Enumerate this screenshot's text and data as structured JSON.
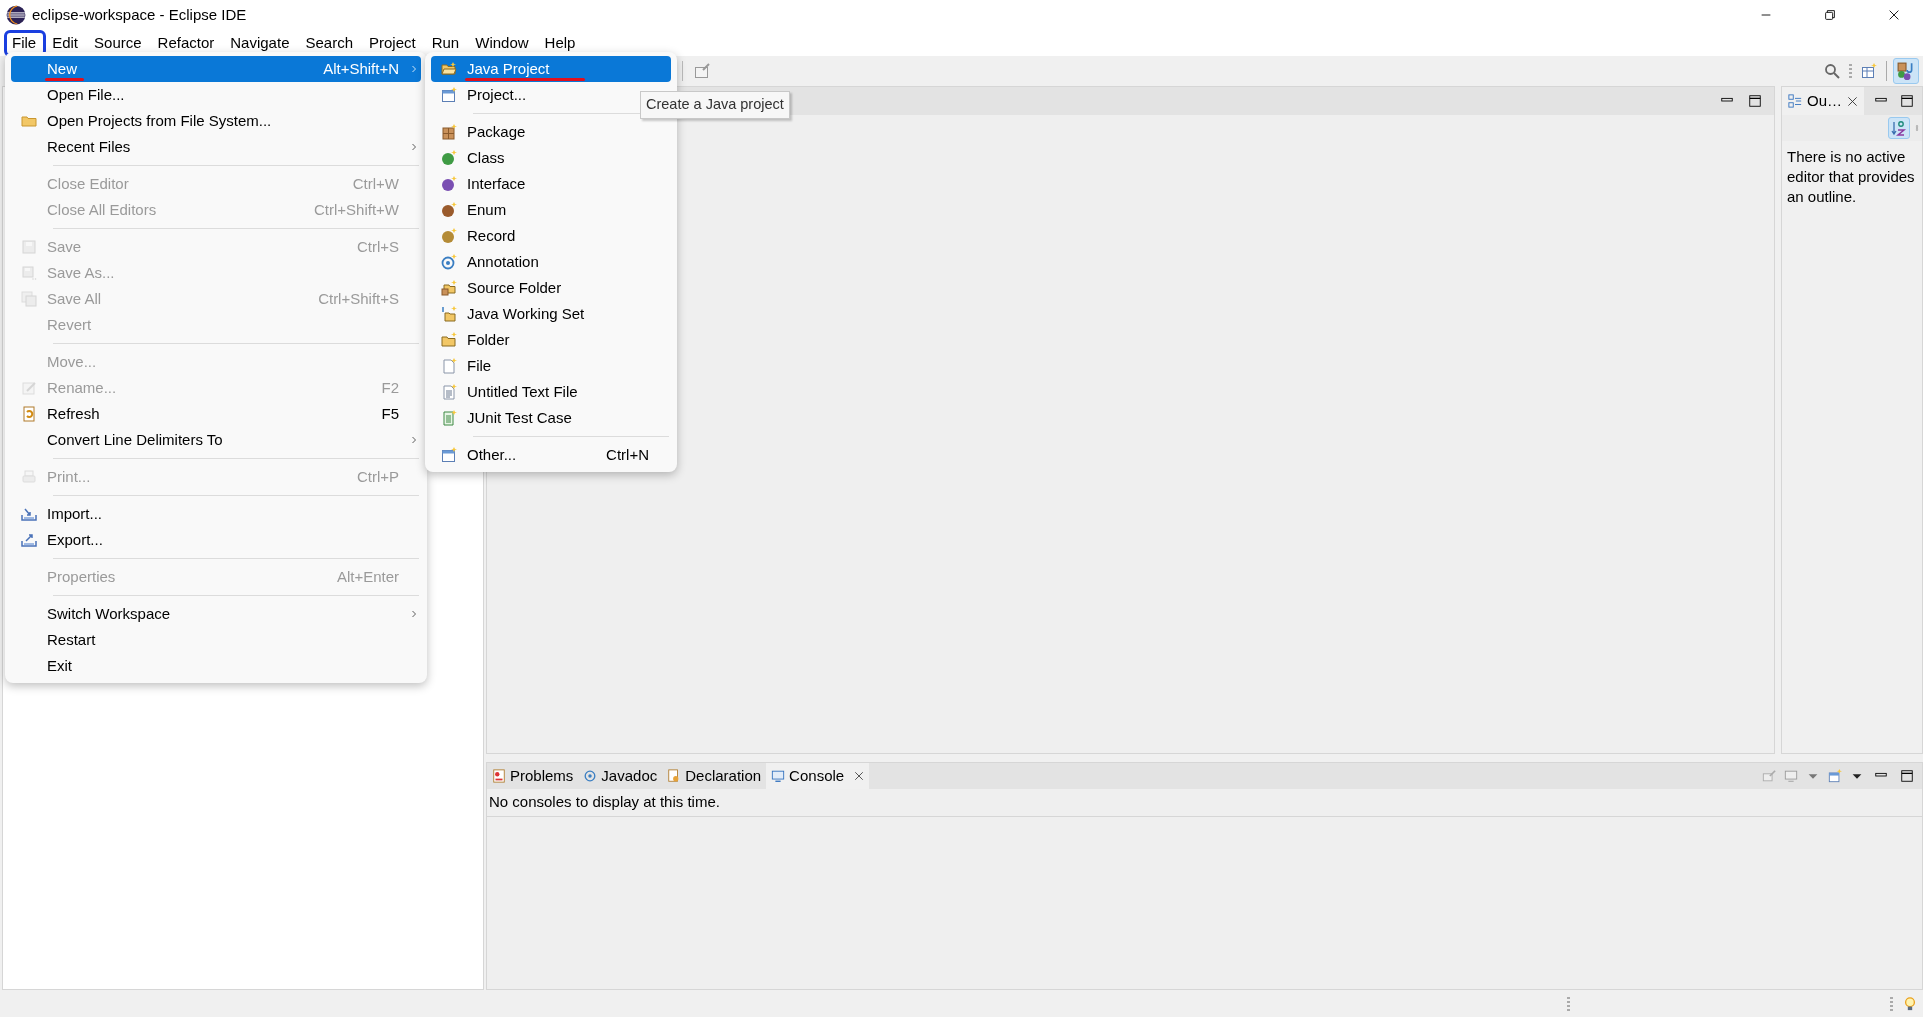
{
  "window": {
    "title": "eclipse-workspace - Eclipse IDE"
  },
  "menubar": [
    {
      "label": "File",
      "annotated": true
    },
    {
      "label": "Edit",
      "annotated": false
    },
    {
      "label": "Source",
      "annotated": false
    },
    {
      "label": "Refactor",
      "annotated": false
    },
    {
      "label": "Navigate",
      "annotated": false
    },
    {
      "label": "Search",
      "annotated": false
    },
    {
      "label": "Project",
      "annotated": false
    },
    {
      "label": "Run",
      "annotated": false
    },
    {
      "label": "Window",
      "annotated": false
    },
    {
      "label": "Help",
      "annotated": false
    }
  ],
  "file_menu": [
    {
      "kind": "item",
      "label": "New",
      "shortcut": "Alt+Shift+N",
      "submenu": true,
      "disabled": false,
      "selected": true,
      "annotated": true
    },
    {
      "kind": "item",
      "label": "Open File...",
      "disabled": false,
      "selected": false
    },
    {
      "kind": "item",
      "label": "Open Projects from File System...",
      "disabled": false,
      "selected": false
    },
    {
      "kind": "item",
      "label": "Recent Files",
      "submenu": true,
      "disabled": false,
      "selected": false
    },
    {
      "kind": "separator"
    },
    {
      "kind": "item",
      "label": "Close Editor",
      "shortcut": "Ctrl+W",
      "disabled": true,
      "selected": false
    },
    {
      "kind": "item",
      "label": "Close All Editors",
      "shortcut": "Ctrl+Shift+W",
      "disabled": true,
      "selected": false
    },
    {
      "kind": "separator"
    },
    {
      "kind": "item",
      "label": "Save",
      "shortcut": "Ctrl+S",
      "disabled": true,
      "selected": false
    },
    {
      "kind": "item",
      "label": "Save As...",
      "disabled": true,
      "selected": false
    },
    {
      "kind": "item",
      "label": "Save All",
      "shortcut": "Ctrl+Shift+S",
      "disabled": true,
      "selected": false
    },
    {
      "kind": "item",
      "label": "Revert",
      "disabled": true,
      "selected": false
    },
    {
      "kind": "separator"
    },
    {
      "kind": "item",
      "label": "Move...",
      "disabled": true,
      "selected": false
    },
    {
      "kind": "item",
      "label": "Rename...",
      "shortcut": "F2",
      "disabled": true,
      "selected": false
    },
    {
      "kind": "item",
      "label": "Refresh",
      "shortcut": "F5",
      "disabled": false,
      "selected": false
    },
    {
      "kind": "item",
      "label": "Convert Line Delimiters To",
      "submenu": true,
      "disabled": false,
      "selected": false
    },
    {
      "kind": "separator"
    },
    {
      "kind": "item",
      "label": "Print...",
      "shortcut": "Ctrl+P",
      "disabled": true,
      "selected": false
    },
    {
      "kind": "separator"
    },
    {
      "kind": "item",
      "label": "Import...",
      "disabled": false,
      "selected": false
    },
    {
      "kind": "item",
      "label": "Export...",
      "disabled": false,
      "selected": false
    },
    {
      "kind": "separator"
    },
    {
      "kind": "item",
      "label": "Properties",
      "shortcut": "Alt+Enter",
      "disabled": true,
      "selected": false
    },
    {
      "kind": "separator"
    },
    {
      "kind": "item",
      "label": "Switch Workspace",
      "submenu": true,
      "disabled": false,
      "selected": false
    },
    {
      "kind": "item",
      "label": "Restart",
      "disabled": false,
      "selected": false
    },
    {
      "kind": "item",
      "label": "Exit",
      "disabled": false,
      "selected": false
    }
  ],
  "new_submenu": [
    {
      "kind": "item",
      "label": "Java Project",
      "selected": true,
      "annotated": true
    },
    {
      "kind": "item",
      "label": "Project...",
      "selected": false
    },
    {
      "kind": "separator"
    },
    {
      "kind": "item",
      "label": "Package",
      "selected": false
    },
    {
      "kind": "item",
      "label": "Class",
      "selected": false
    },
    {
      "kind": "item",
      "label": "Interface",
      "selected": false
    },
    {
      "kind": "item",
      "label": "Enum",
      "selected": false
    },
    {
      "kind": "item",
      "label": "Record",
      "selected": false
    },
    {
      "kind": "item",
      "label": "Annotation",
      "selected": false
    },
    {
      "kind": "item",
      "label": "Source Folder",
      "selected": false
    },
    {
      "kind": "item",
      "label": "Java Working Set",
      "selected": false
    },
    {
      "kind": "item",
      "label": "Folder",
      "selected": false
    },
    {
      "kind": "item",
      "label": "File",
      "selected": false
    },
    {
      "kind": "item",
      "label": "Untitled Text File",
      "selected": false
    },
    {
      "kind": "item",
      "label": "JUnit Test Case",
      "selected": false
    },
    {
      "kind": "separator"
    },
    {
      "kind": "item",
      "label": "Other...",
      "shortcut": "Ctrl+N",
      "selected": false
    }
  ],
  "tooltip": {
    "text": "Create a Java project"
  },
  "toolbar": {
    "java_perspective_selected": true
  },
  "outline": {
    "tab_label": "Ou…",
    "sort_selected": true,
    "message": "There is no active editor that provides an outline."
  },
  "bottom_panel": {
    "tabs": [
      {
        "label": "Problems",
        "selected": false
      },
      {
        "label": "Javadoc",
        "selected": false
      },
      {
        "label": "Declaration",
        "selected": false
      },
      {
        "label": "Console",
        "selected": true
      }
    ],
    "message": "No consoles to display at this time."
  }
}
